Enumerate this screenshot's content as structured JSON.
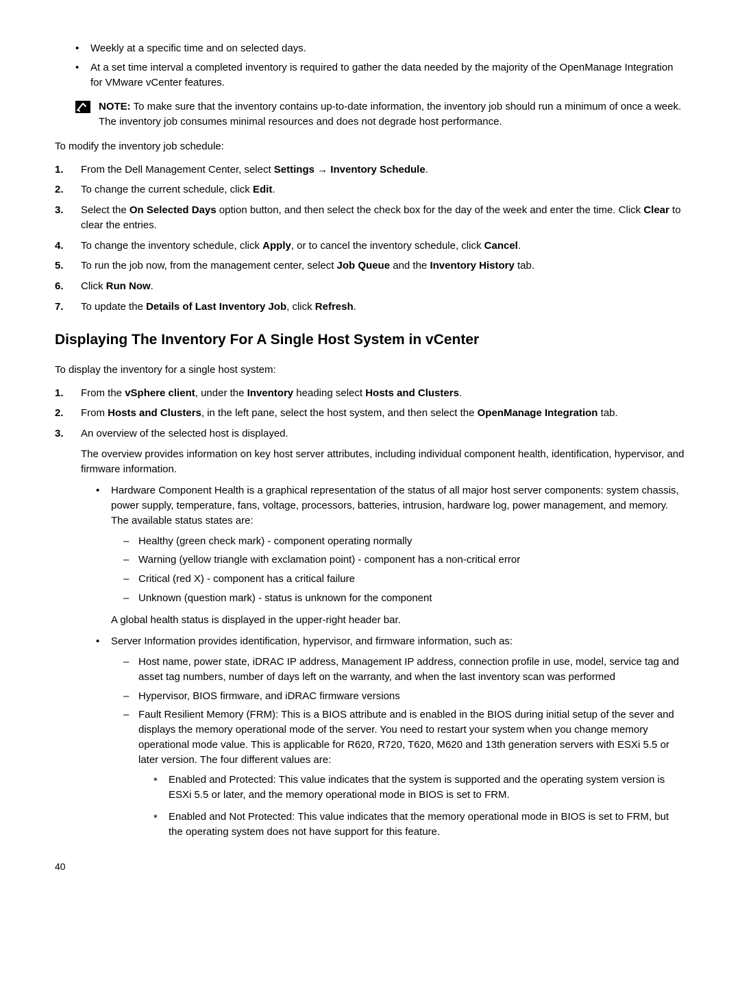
{
  "top_bullets": [
    "Weekly at a specific time and on selected days.",
    "At a set time interval a completed inventory is required to gather the data needed by the majority of the OpenManage Integration for VMware vCenter features."
  ],
  "note": {
    "label": "NOTE:",
    "text": " To make sure that the inventory contains up-to-date information, the inventory job should run a minimum of once a week. The inventory job consumes minimal resources and does not degrade host performance."
  },
  "para_modify": "To modify the inventory job schedule:",
  "steps1": {
    "s1a": "From the Dell Management Center, select ",
    "s1b": "Settings → Inventory Schedule",
    "s1c": ".",
    "s2a": "To change the current schedule, click ",
    "s2b": "Edit",
    "s2c": ".",
    "s3a": "Select the ",
    "s3b": "On Selected Days",
    "s3c": " option button, and then select the check box for the day of the week and enter the time. Click ",
    "s3d": "Clear",
    "s3e": " to clear the entries.",
    "s4a": "To change the inventory schedule, click ",
    "s4b": "Apply",
    "s4c": ", or to cancel the inventory schedule, click ",
    "s4d": "Cancel",
    "s4e": ".",
    "s5a": "To run the job now, from the management center, select ",
    "s5b": "Job Queue",
    "s5c": " and the ",
    "s5d": "Inventory History",
    "s5e": " tab.",
    "s6a": "Click ",
    "s6b": "Run Now",
    "s6c": ".",
    "s7a": "To update the ",
    "s7b": "Details of Last Inventory Job",
    "s7c": ", click ",
    "s7d": "Refresh",
    "s7e": "."
  },
  "heading": "Displaying The Inventory For A Single Host System in vCenter",
  "para_display": "To display the inventory for a single host system:",
  "steps2": {
    "s1a": "From the ",
    "s1b": "vSphere client",
    "s1c": ", under the ",
    "s1d": "Inventory",
    "s1e": " heading select ",
    "s1f": "Hosts and Clusters",
    "s1g": ".",
    "s2a": "From ",
    "s2b": "Hosts and Clusters",
    "s2c": ", in the left pane, select the host system, and then select the ",
    "s2d": "OpenManage Integration",
    "s2e": " tab.",
    "s3a": "An overview of the selected host is displayed.",
    "s3_p": "The overview provides information on key host server attributes, including individual component health, identification, hypervisor, and firmware information."
  },
  "inner": {
    "b1": "Hardware Component Health is a graphical representation of the status of all major host server components: system chassis, power supply, temperature, fans, voltage, processors, batteries, intrusion, hardware log, power management, and memory. The available status states are:",
    "b1_dash": [
      "Healthy (green check mark) - component operating normally",
      "Warning (yellow triangle with exclamation point) - component has a non-critical error",
      "Critical (red X) - component has a critical failure",
      "Unknown (question mark) - status is unknown for the component"
    ],
    "b1_after": "A global health status is displayed in the upper-right header bar.",
    "b2": "Server Information provides identification, hypervisor, and firmware information, such as:",
    "b2_d1": "Host name, power state, iDRAC IP address, Management IP address, connection profile in use, model, service tag and asset tag numbers, number of days left on the warranty, and when the last inventory scan was performed",
    "b2_d2": "Hypervisor, BIOS firmware, and iDRAC firmware versions",
    "b2_d3": "Fault Resilient Memory (FRM): This is a BIOS attribute and is enabled in the BIOS during initial setup of the sever and displays the memory operational mode of the server. You need to restart your system when you change memory operational mode value. This is applicable for R620, R720, T620, M620 and 13th generation servers with ESXi 5.5 or later version. The four different values are:",
    "b2_star": [
      "Enabled and Protected: This value indicates that the system is supported and the operating system version is ESXi 5.5 or later, and the memory operational mode in BIOS is set to FRM.",
      "Enabled and Not Protected: This value indicates that the memory operational mode in BIOS is set to FRM, but the operating system does not have support for this feature."
    ]
  },
  "page_number": "40"
}
